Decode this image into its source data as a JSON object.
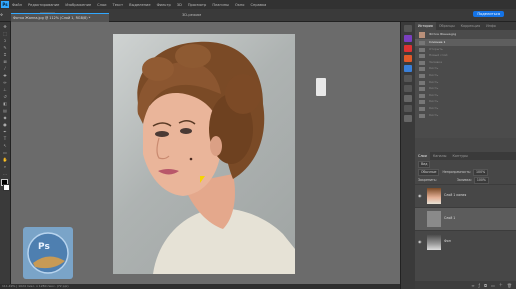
{
  "menu": {
    "app": "Ps",
    "items": [
      "Файл",
      "Редактирование",
      "Изображение",
      "Слои",
      "Текст",
      "Выделение",
      "Фильтр",
      "3D",
      "Просмотр",
      "Плагины",
      "Окно",
      "Справка"
    ]
  },
  "options": {
    "auto_select_label": "Автовыбор",
    "auto_select_value": "Слой",
    "transform_label": "Показать упр. элем.",
    "mode_label": "3D-режим",
    "share_label": "Поделиться"
  },
  "document_tab": "Фотка Жанна.jpg @ 112% (Слой 1, RGB/8) *",
  "status_text": "111.49% | 1024 пикс. x 1280 пикс. (72 ppi)",
  "history_panel": {
    "tabs": [
      "История",
      "Образцы",
      "Коррекция",
      "Инфо"
    ],
    "snapshot": "Фотка Жанна.jpg",
    "items": [
      "Слияние 1",
      "Открыть",
      "Новый слой",
      "Заливка",
      "Кисть",
      "Кисть",
      "Кисть",
      "Кисть",
      "Кисть",
      "Кисть",
      "Кисть",
      "Кисть"
    ]
  },
  "layers_panel": {
    "tabs": [
      "Слои",
      "Каналы",
      "Контуры"
    ],
    "filter_label": "Вид",
    "blend_mode": "Обычные",
    "opacity_label": "Непрозрачность:",
    "opacity_value": "100%",
    "lock_label": "Закрепить:",
    "fill_label": "Заливка:",
    "fill_value": "100%",
    "layers": [
      {
        "name": "Слой 1 копия",
        "visible": true,
        "selected": false
      },
      {
        "name": "Слой 1",
        "visible": false,
        "selected": true
      },
      {
        "name": "Фон",
        "visible": true,
        "selected": false
      }
    ]
  },
  "colors": {
    "accent": "#31a8ff",
    "share": "#1473e6",
    "canvas_bg": "#6b6b6b"
  }
}
